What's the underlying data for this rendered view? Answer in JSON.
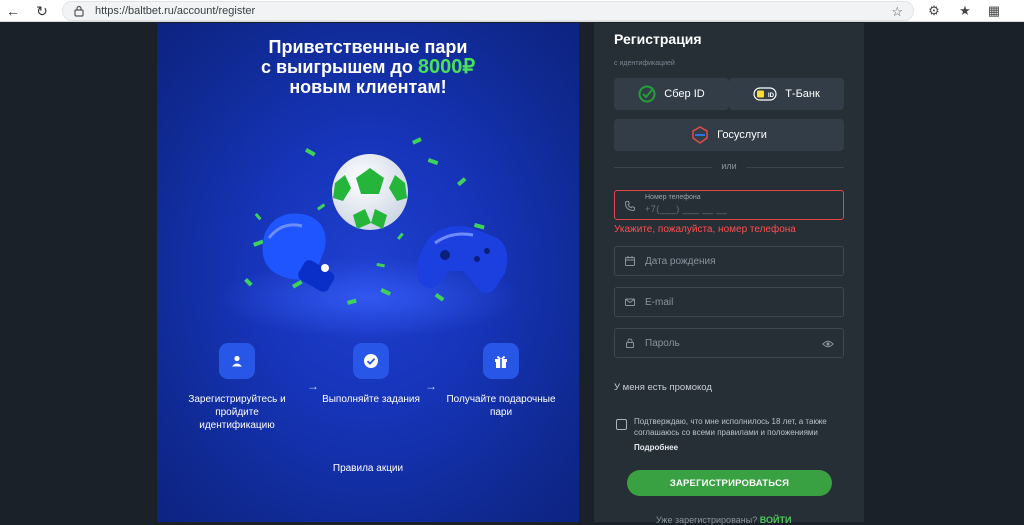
{
  "browser": {
    "url": "https://baltbet.ru/account/register",
    "icons": [
      "back-icon",
      "refresh-icon",
      "lock-icon",
      "star-icon",
      "extensions-icon",
      "favorites-icon",
      "collections-icon"
    ]
  },
  "promo": {
    "title_line1": "Приветственные пари",
    "title_line2_prefix": "с выигрышем до ",
    "title_amount": "8000₽",
    "title_line3": "новым клиентам!",
    "steps": [
      {
        "icon": "user-icon",
        "text": "Зарегистрируйтесь и пройдите идентификацию"
      },
      {
        "icon": "check-icon",
        "text": "Выполняйте задания"
      },
      {
        "icon": "gift-icon",
        "text": "Получайте подарочные пари"
      }
    ],
    "rules_link": "Правила акции"
  },
  "form": {
    "title": "Регистрация",
    "id_label": "с идентификацией",
    "sber_label": "Сбер ID",
    "tbank_label": "Т-Банк",
    "gosuslugi_label": "Госуслуги",
    "or_text": "или",
    "phone_label": "Номер телефона",
    "phone_value": "+7(___) ___ __ __",
    "phone_error": "Укажите, пожалуйста, номер телефона",
    "birthdate_placeholder": "Дата рождения",
    "email_placeholder": "E-mail",
    "password_placeholder": "Пароль",
    "promo_code_text": "У меня есть промокод",
    "consent_text": "Подтверждаю, что мне исполнилось 18 лет, а также соглашаюсь со всеми правилами и положениями",
    "more_link": "Подробнее",
    "register_button": "ЗАРЕГИСТРИРОВАТЬСЯ",
    "already_text": "Уже зарегистрированы?",
    "login_link": "ВОЙТИ"
  },
  "colors": {
    "accent_green": "#3aa142",
    "error_red": "#ff4f4f",
    "promo_blue": "#1634b8",
    "form_bg": "#262e36"
  }
}
